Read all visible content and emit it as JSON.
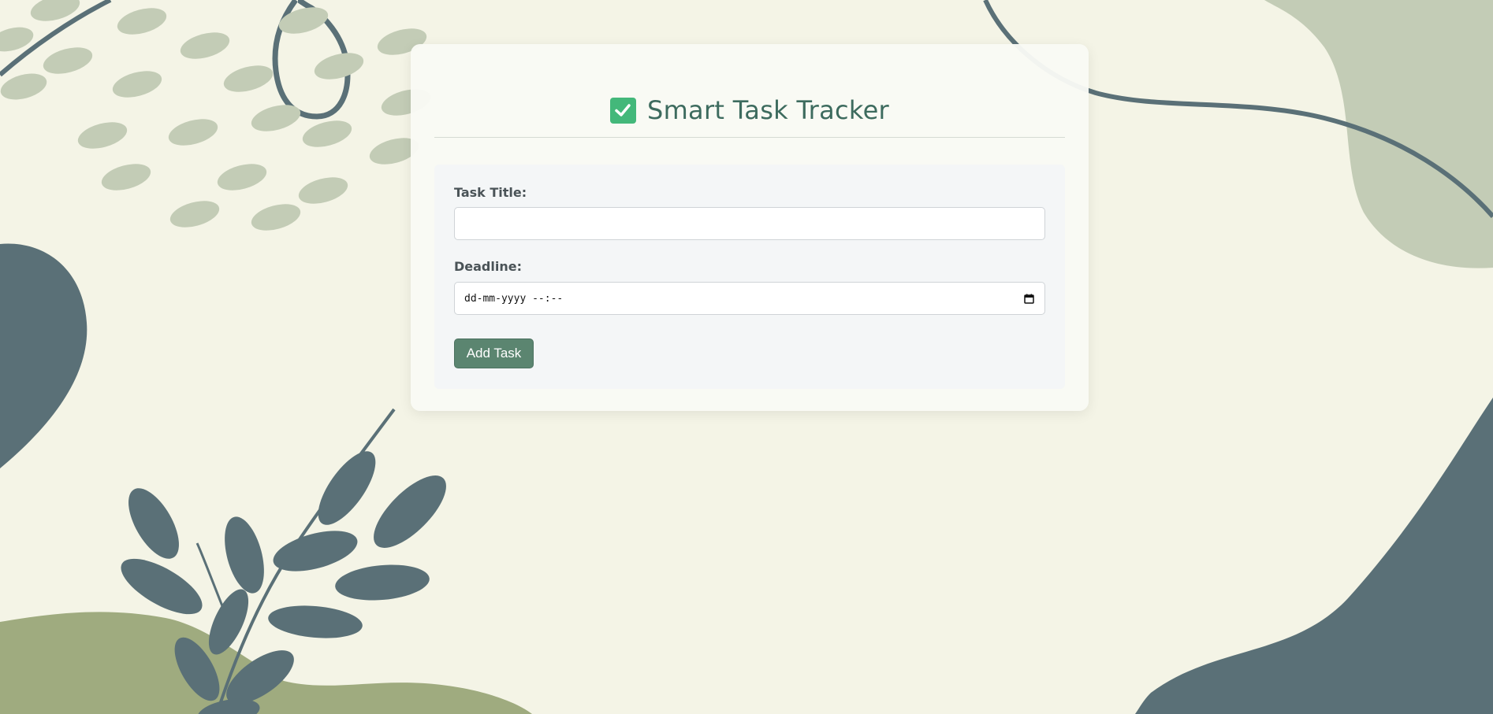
{
  "app": {
    "title": "Smart Task Tracker",
    "title_icon": "check-box-icon"
  },
  "form": {
    "task_title_label": "Task Title:",
    "task_title_value": "",
    "task_title_placeholder": "",
    "deadline_label": "Deadline:",
    "deadline_placeholder": "dd-mm-yyyy --:--",
    "deadline_icon": "calendar-icon",
    "add_button_label": "Add Task"
  },
  "colors": {
    "background": "#f4f4e6",
    "accent": "#5b8570",
    "title": "#3d6b5e",
    "check": "#43b87a",
    "leaf_dark": "#5a7077",
    "leaf_light": "#c3ccb6",
    "olive": "#9fab7f"
  }
}
